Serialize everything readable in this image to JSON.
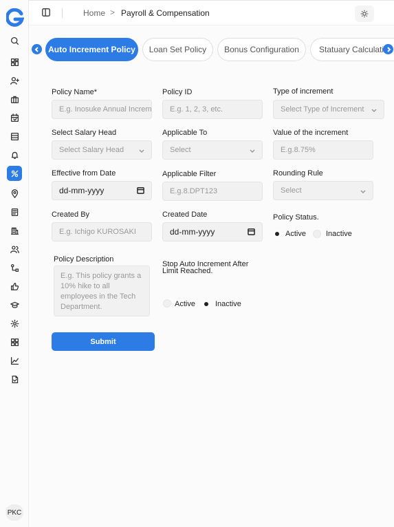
{
  "app": {
    "logo_letter": "G",
    "avatar": "PKC",
    "brand_color": "#2d7be5"
  },
  "sidebar": {
    "items": [
      {
        "icon": "search-icon"
      },
      {
        "icon": "dashboard-icon"
      },
      {
        "icon": "add-user-icon"
      },
      {
        "icon": "briefcase-icon"
      },
      {
        "icon": "calendar-icon"
      },
      {
        "icon": "inbox-icon"
      },
      {
        "icon": "bell-icon"
      },
      {
        "icon": "payroll-icon",
        "active": true
      },
      {
        "icon": "location-icon"
      },
      {
        "icon": "document-icon"
      },
      {
        "icon": "building-icon"
      },
      {
        "icon": "users-icon"
      },
      {
        "icon": "flow-icon"
      },
      {
        "icon": "thumbs-up-icon"
      },
      {
        "icon": "graduation-cap-icon"
      },
      {
        "icon": "settings-icon"
      },
      {
        "icon": "apps-icon"
      },
      {
        "icon": "chart-icon"
      },
      {
        "icon": "file-icon"
      }
    ]
  },
  "header": {
    "breadcrumb_home": "Home",
    "breadcrumb_sep": ">",
    "breadcrumb_current": "Payroll & Compensation"
  },
  "tabs": [
    {
      "label": "Auto Increment Policy",
      "active": true
    },
    {
      "label": "Loan Set Policy"
    },
    {
      "label": "Bonus Configuration"
    },
    {
      "label": "Statuary Calculation"
    }
  ],
  "form": {
    "policy_name": {
      "label": "Policy Name*",
      "placeholder": "E.g. Inosuke Annual Increment"
    },
    "policy_id": {
      "label": "Policy ID",
      "placeholder": "E.g. 1, 2, 3, etc."
    },
    "type_of_increment": {
      "label": "Type of increment",
      "value": "Select Type of Increment"
    },
    "salary_head": {
      "label": "Select Salary Head",
      "value": "Select Salary Head"
    },
    "applicable_to": {
      "label": "Applicable To",
      "value": "Select"
    },
    "increment_value": {
      "label": "Value of the increment",
      "placeholder": "E.g.8.75%"
    },
    "effective_from": {
      "label": "Effective from Date",
      "value": "dd-mm-yyyy"
    },
    "applicable_filter": {
      "label": "Applicable Filter",
      "placeholder": "E.g.8.DPT123"
    },
    "rounding_rule": {
      "label": "Rounding Rule",
      "value": "Select"
    },
    "created_by": {
      "label": "Created By",
      "placeholder": "E.g. Ichigo KUROSAKI"
    },
    "created_date": {
      "label": "Created Date",
      "value": "dd-mm-yyyy"
    },
    "policy_status": {
      "label": "Policy Status.",
      "option_active": "Active",
      "option_inactive": "Inactive",
      "selected": "Active"
    },
    "description": {
      "label": "Policy Description",
      "placeholder": "E.g. This policy grants a 10% hike to all employees in the Tech Department."
    },
    "stop_auto": {
      "label": "Stop Auto Increment After Limit Reached.",
      "option_active": "Active",
      "option_inactive": "Inactive",
      "selected": "Inactive"
    },
    "submit_label": "Submit"
  }
}
